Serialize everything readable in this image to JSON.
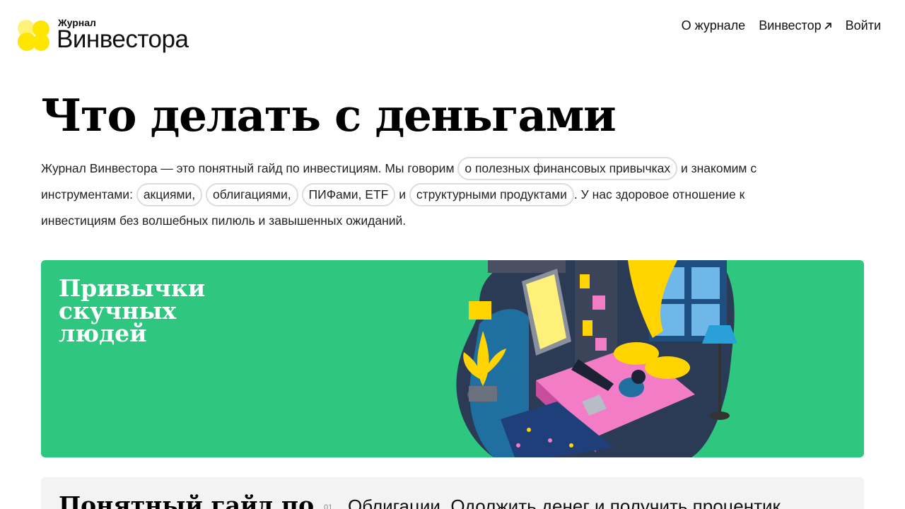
{
  "header": {
    "logo_small": "Журнал",
    "logo_big": "Винвестора",
    "nav": [
      {
        "label": "О журнале"
      },
      {
        "label": "Винвестор"
      },
      {
        "label": "Войти"
      }
    ]
  },
  "page_title": "Что делать с деньгами",
  "intro": {
    "text1": "Журнал Винвестора — это понятный гайд по инвестициям. Мы говорим ",
    "chip_habits": "о полезных финансовых привычках",
    "text2": " и знакомим с инструментами: ",
    "chip_stocks": "акциями,",
    "chip_bonds": "облигациями,",
    "chip_funds": "ПИФами, ETF",
    "text3": " и ",
    "chip_structured": "структурными продуктами",
    "text4": ". У нас здоровое отношение к инвестициям без волшебных пилюль и завышенных ожиданий."
  },
  "card": {
    "title": "Привычки скучных людей",
    "bg_color": "#2fc780"
  },
  "panel": {
    "title": "Понятный гайд по",
    "item_number": "01",
    "item_label": "Облигации. Одолжить денег и получить процентик"
  },
  "colors": {
    "brand_yellow": "#ffe600",
    "card_green": "#2fc780"
  }
}
